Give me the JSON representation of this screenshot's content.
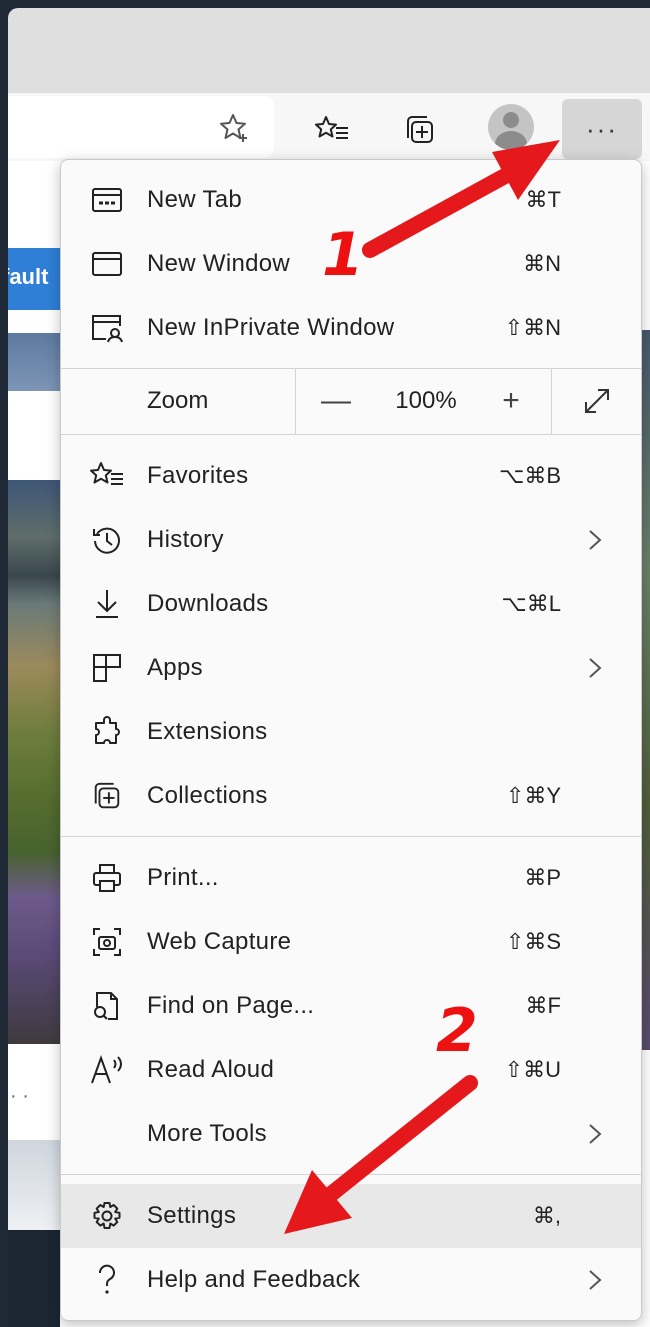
{
  "browser": {
    "more_button_glyph": "···",
    "sidebar_tab_text": "fault",
    "page_dots": "· ·"
  },
  "menu": {
    "items_top": [
      {
        "label": "New Tab",
        "shortcut": "⌘T",
        "icon": "new-tab-icon"
      },
      {
        "label": "New Window",
        "shortcut": "⌘N",
        "icon": "new-window-icon"
      },
      {
        "label": "New InPrivate Window",
        "shortcut": "⇧⌘N",
        "icon": "inprivate-window-icon"
      }
    ],
    "zoom": {
      "label": "Zoom",
      "minus": "—",
      "value": "100%",
      "plus": "+"
    },
    "items_mid": [
      {
        "label": "Favorites",
        "shortcut": "⌥⌘B",
        "icon": "favorites-icon"
      },
      {
        "label": "History",
        "shortcut": "",
        "icon": "history-icon",
        "submenu": true
      },
      {
        "label": "Downloads",
        "shortcut": "⌥⌘L",
        "icon": "downloads-icon"
      },
      {
        "label": "Apps",
        "shortcut": "",
        "icon": "apps-icon",
        "submenu": true
      },
      {
        "label": "Extensions",
        "shortcut": "",
        "icon": "extensions-icon"
      },
      {
        "label": "Collections",
        "shortcut": "⇧⌘Y",
        "icon": "collections-icon"
      }
    ],
    "items_tools": [
      {
        "label": "Print...",
        "shortcut": "⌘P",
        "icon": "print-icon"
      },
      {
        "label": "Web Capture",
        "shortcut": "⇧⌘S",
        "icon": "web-capture-icon"
      },
      {
        "label": "Find on Page...",
        "shortcut": "⌘F",
        "icon": "find-on-page-icon"
      },
      {
        "label": "Read Aloud",
        "shortcut": "⇧⌘U",
        "icon": "read-aloud-icon"
      },
      {
        "label": "More Tools",
        "shortcut": "",
        "icon": "",
        "submenu": true
      }
    ],
    "items_bottom": [
      {
        "label": "Settings",
        "shortcut": "⌘,",
        "icon": "settings-icon",
        "highlighted": true
      },
      {
        "label": "Help and Feedback",
        "shortcut": "",
        "icon": "help-icon",
        "submenu": true
      }
    ]
  },
  "annotations": {
    "step1": "1",
    "step2": "2",
    "arrow_color": "#e5191b"
  }
}
